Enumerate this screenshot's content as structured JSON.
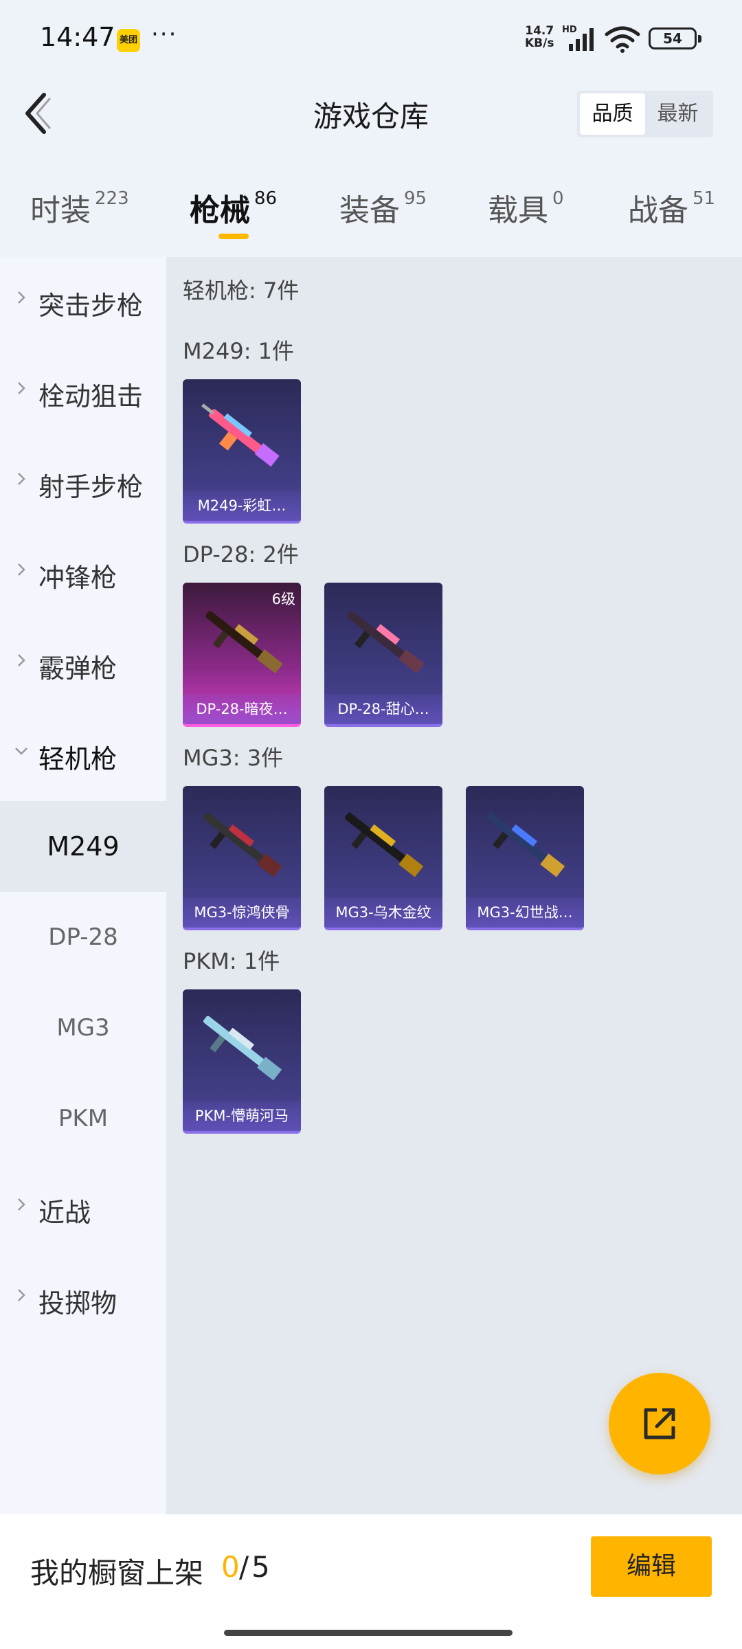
{
  "status_bar": {
    "time": "14:47",
    "app_badge": "美团",
    "speed_value": "14.7",
    "speed_unit": "KB/s",
    "network_label": "HD",
    "battery": "54"
  },
  "header": {
    "title": "游戏仓库",
    "sort_options": [
      "品质",
      "最新"
    ],
    "active_sort": "品质"
  },
  "tabs": [
    {
      "label": "时装",
      "count": "223"
    },
    {
      "label": "枪械",
      "count": "86",
      "active": true
    },
    {
      "label": "装备",
      "count": "95"
    },
    {
      "label": "载具",
      "count": "0"
    },
    {
      "label": "战备",
      "count": "51"
    }
  ],
  "sidebar": {
    "categories": [
      {
        "label": "突击步枪"
      },
      {
        "label": "栓动狙击"
      },
      {
        "label": "射手步枪"
      },
      {
        "label": "冲锋枪"
      },
      {
        "label": "霰弹枪"
      },
      {
        "label": "轻机枪",
        "expanded": true
      },
      {
        "label": "近战"
      },
      {
        "label": "投掷物"
      }
    ],
    "subcategories": [
      "M249",
      "DP-28",
      "MG3",
      "PKM"
    ],
    "active_sub": "M249"
  },
  "content": {
    "summary": "轻机枪: 7件",
    "groups": [
      {
        "title": "M249: 1件",
        "items": [
          {
            "name": "M249-彩虹…",
            "icon": "light-machine-gun-skin-rainbow"
          }
        ]
      },
      {
        "title": "DP-28: 2件",
        "items": [
          {
            "name": "DP-28-暗夜…",
            "icon": "light-machine-gun-skin-dark",
            "level": "6级",
            "color": "#d23ec4"
          },
          {
            "name": "DP-28-甜心…",
            "icon": "light-machine-gun-skin-sweet"
          }
        ]
      },
      {
        "title": "MG3: 3件",
        "items": [
          {
            "name": "MG3-惊鸿侠骨",
            "icon": "light-machine-gun-skin-red"
          },
          {
            "name": "MG3-乌木金纹",
            "icon": "light-machine-gun-skin-gold"
          },
          {
            "name": "MG3-幻世战…",
            "icon": "light-machine-gun-skin-blue"
          }
        ]
      },
      {
        "title": "PKM: 1件",
        "items": [
          {
            "name": "PKM-懵萌河马",
            "icon": "light-machine-gun-skin-silver"
          }
        ]
      }
    ]
  },
  "bottom_bar": {
    "label": "我的橱窗上架",
    "current": "0",
    "separator": "/",
    "max": "5",
    "edit_label": "编辑"
  },
  "colors": {
    "accent": "#ffb400",
    "card_purple": "#3d3a7d",
    "card_pink": "#d23ec4"
  }
}
